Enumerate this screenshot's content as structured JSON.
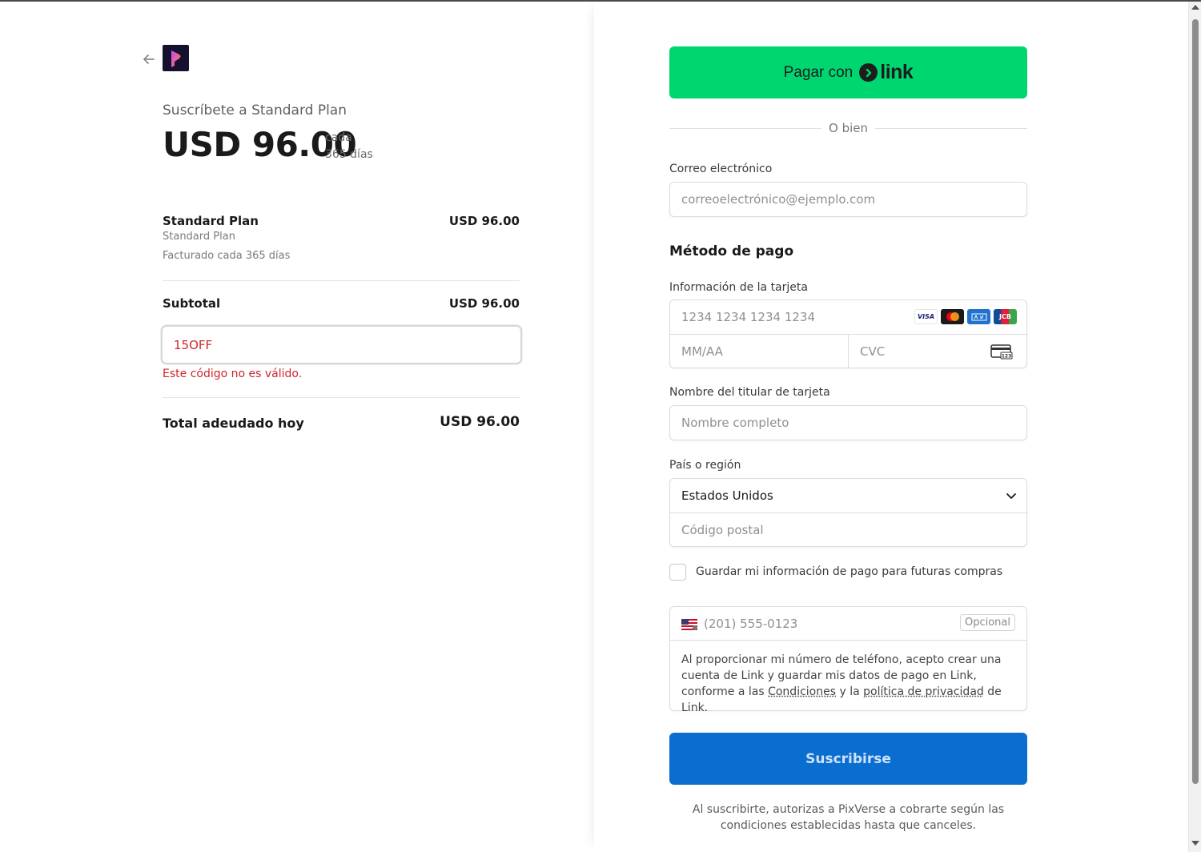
{
  "summary": {
    "subscribe_title": "Suscríbete a Standard Plan",
    "price": "USD 96.00",
    "period_line1": "cada",
    "period_line2": "365 días",
    "item_name": "Standard Plan",
    "item_price": "USD 96.00",
    "item_desc": "Standard Plan",
    "item_billing": "Facturado cada 365 días",
    "subtotal_label": "Subtotal",
    "subtotal_value": "USD 96.00",
    "promo_code_value": "15OFF",
    "promo_error": "Este código no es válido.",
    "total_label": "Total adeudado hoy",
    "total_value": "USD 96.00"
  },
  "payment": {
    "link_button_label": "Pagar con",
    "link_brand": "link",
    "or_text": "O bien",
    "email_label": "Correo electrónico",
    "email_placeholder": "correoelectrónico@ejemplo.com",
    "method_title": "Método de pago",
    "card_label": "Información de la tarjeta",
    "card_number_placeholder": "1234 1234 1234 1234",
    "card_exp_placeholder": "MM/AA",
    "card_cvc_placeholder": "CVC",
    "card_brands": [
      "VISA",
      "Mastercard",
      "AMEX",
      "JCB"
    ],
    "holder_label": "Nombre del titular de tarjeta",
    "holder_placeholder": "Nombre completo",
    "country_label": "País o región",
    "country_value": "Estados Unidos",
    "postal_placeholder": "Código postal",
    "save_info_label": "Guardar mi información de pago para futuras compras",
    "save_info_checked": false,
    "phone_placeholder": "(201) 555-0123",
    "phone_optional": "Opcional",
    "phone_legal_pre": "Al proporcionar mi número de teléfono, acepto crear una cuenta de Link y guardar mis datos de pago en Link, conforme a las",
    "phone_legal_terms": "Condiciones",
    "phone_legal_mid": "y la",
    "phone_legal_privacy": "política de privacidad",
    "phone_legal_post": "de Link.",
    "subscribe_button": "Suscribirse",
    "footer_legal": "Al suscribirte, autorizas a PixVerse a cobrarte según las condiciones establecidas hasta que canceles."
  },
  "colors": {
    "link_green": "#00d66f",
    "subscribe_blue": "#0a6ed1",
    "error_red": "#d0242b"
  }
}
